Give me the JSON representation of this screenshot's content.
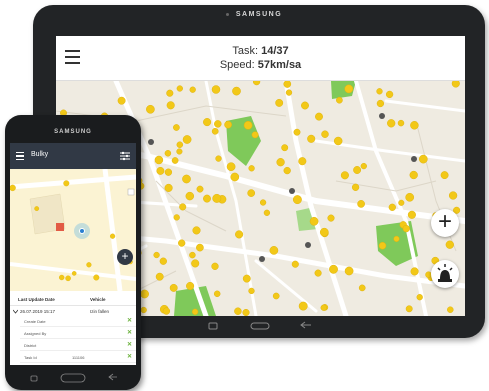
{
  "tablet": {
    "brand": "SAMSUNG",
    "header": {
      "task_label": "Task:",
      "task_value": "14/37",
      "speed_label": "Speed:",
      "speed_value": "57km/sa"
    },
    "fab_add_label": "+"
  },
  "phone": {
    "brand": "SAMSUNG",
    "header_title": "Bulky",
    "fab_add_label": "+",
    "table": {
      "columns": [
        "Last Update Date",
        "Vehicle"
      ],
      "row": {
        "date": "26.07.2019 15:17",
        "vehicle": "Izin fallen"
      },
      "details": [
        {
          "label": "Create Date",
          "value": ""
        },
        {
          "label": "Assigned By",
          "value": ""
        },
        {
          "label": "District",
          "value": ""
        },
        {
          "label": "Task Id",
          "value": "111106"
        }
      ]
    }
  },
  "colors": {
    "marker": "#f2c818",
    "park": "#5bbf3a",
    "phone_header": "#313945",
    "road": "#ffffff",
    "map_bg": "#f2efe9"
  }
}
